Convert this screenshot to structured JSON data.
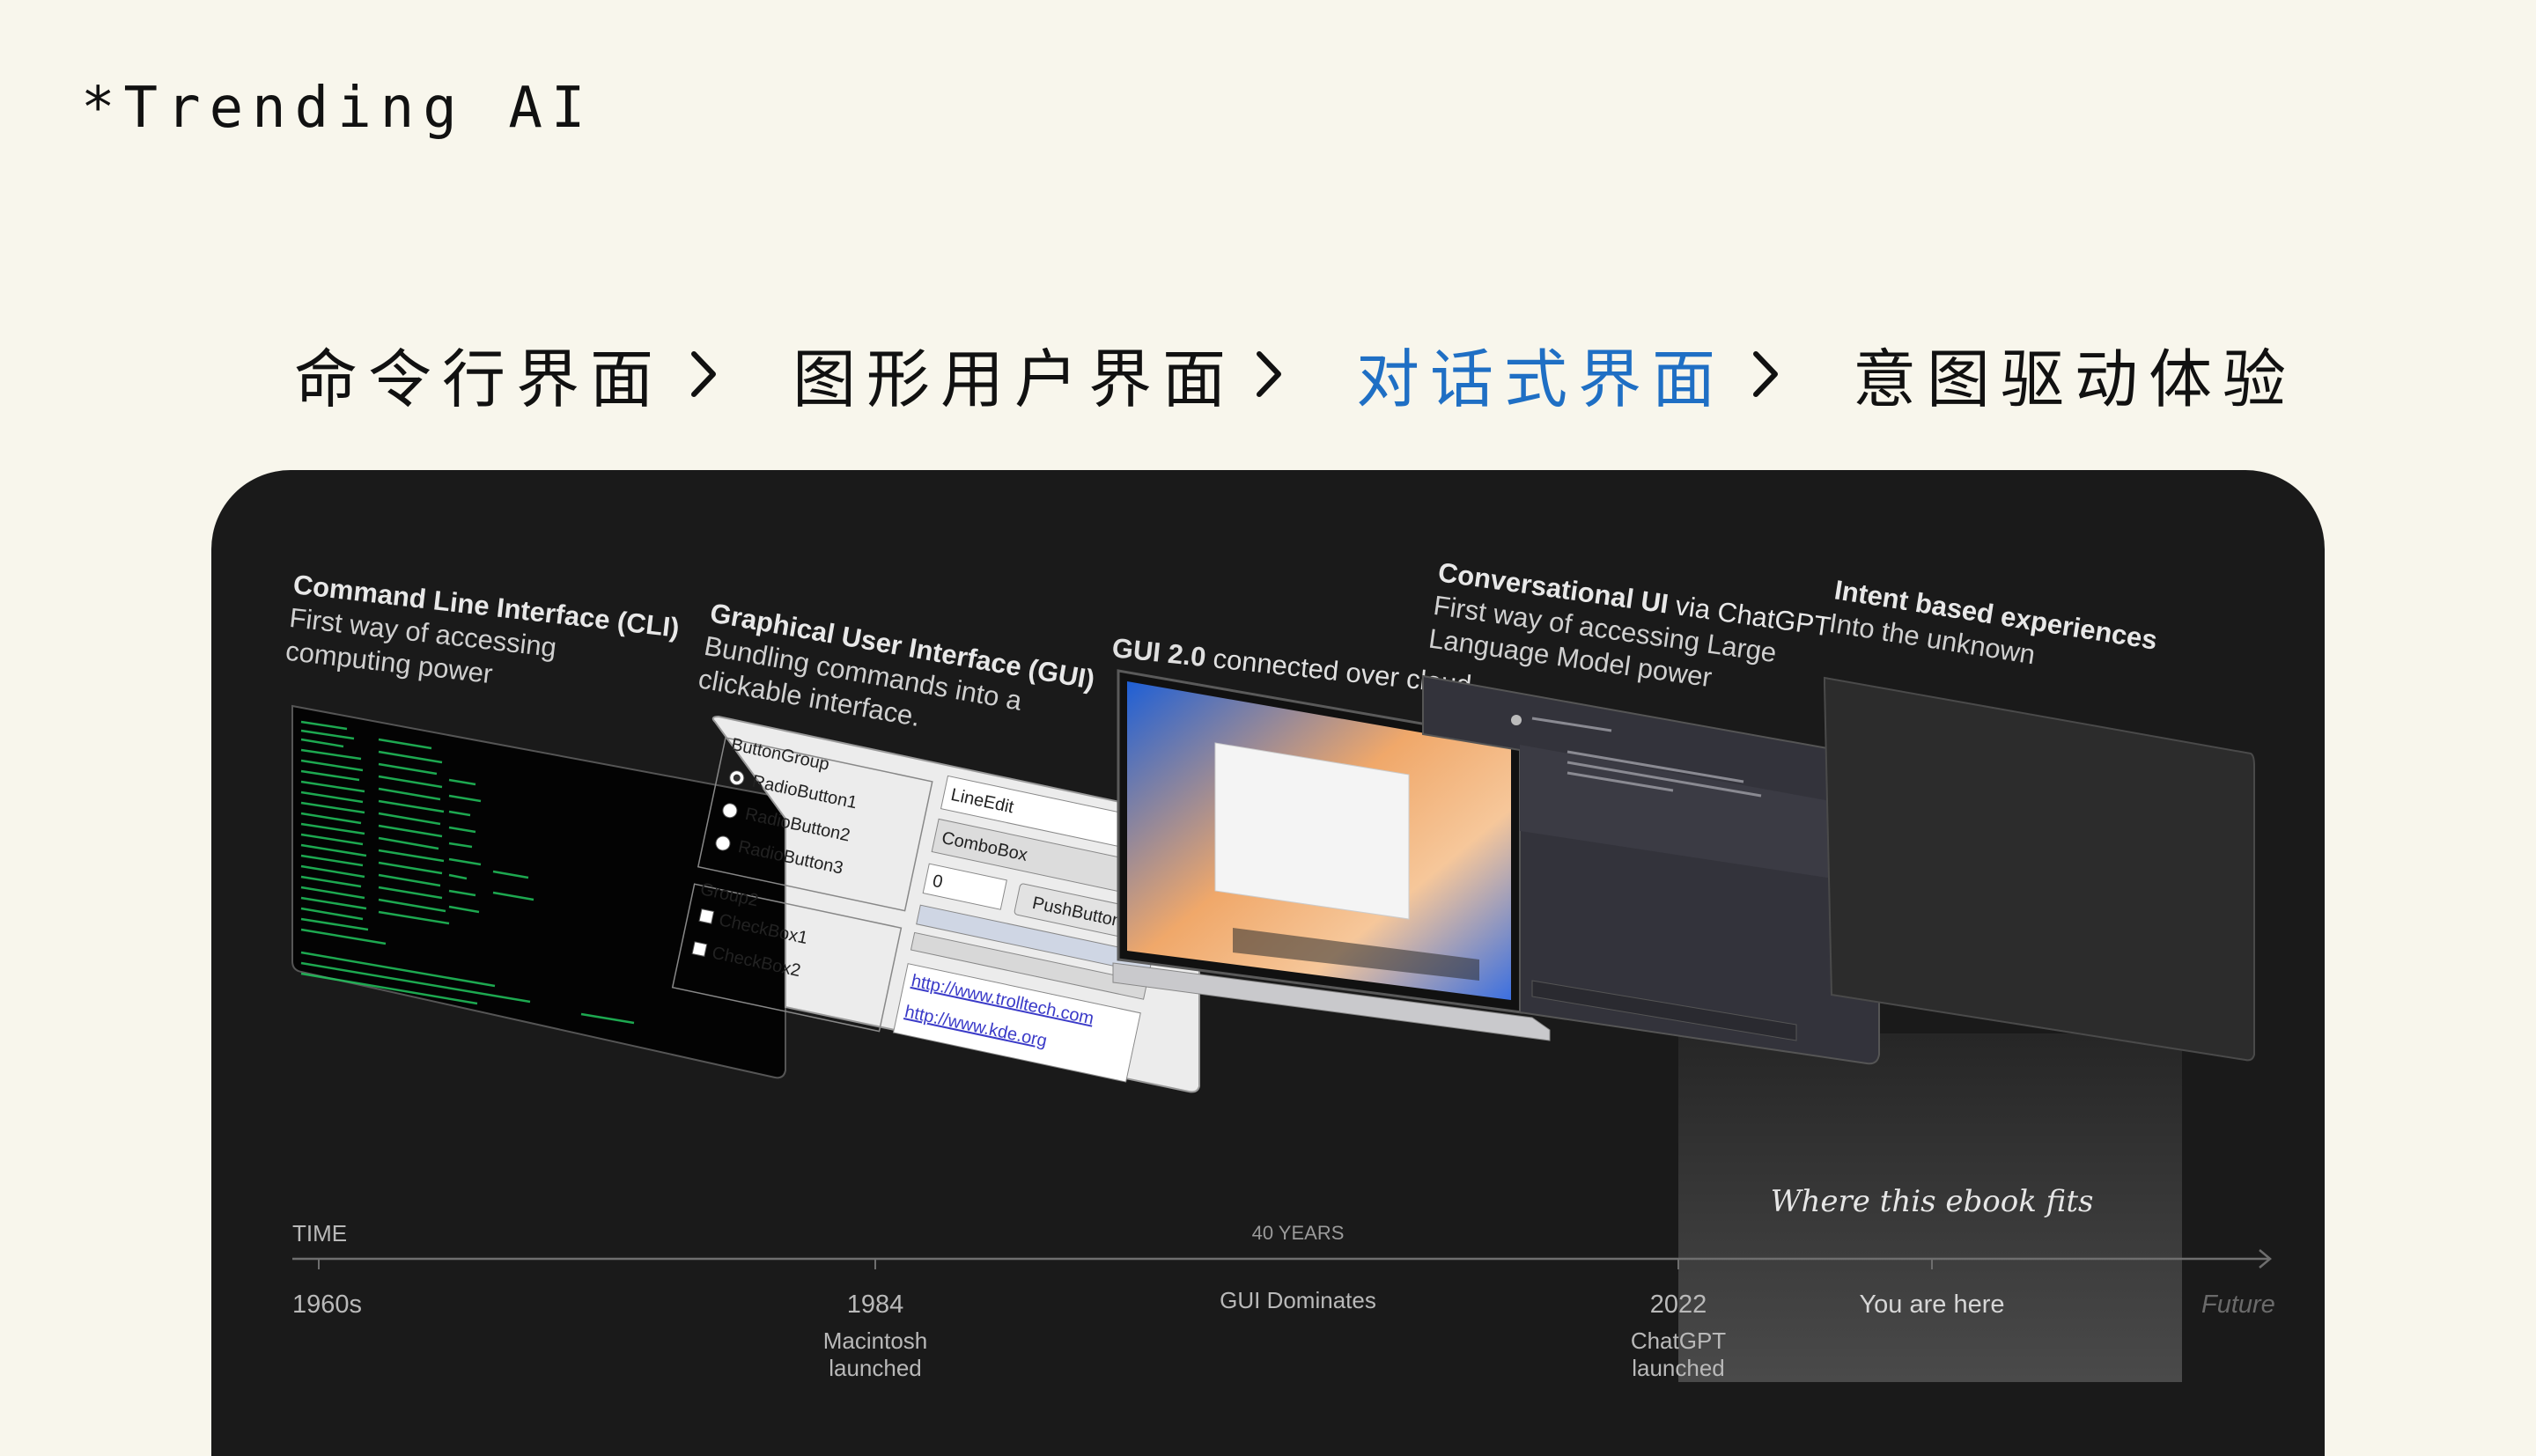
{
  "brand": "*Trending AI",
  "steps": [
    {
      "label": "命令行界面",
      "active": false
    },
    {
      "label": "图形用户界面",
      "active": false
    },
    {
      "label": "对话式界面",
      "active": true
    },
    {
      "label": "意图驱动体验",
      "active": false
    }
  ],
  "colors": {
    "background": "#f8f6ec",
    "panel": "#1a1a1a",
    "accent": "#1f6fc4",
    "terminal_text": "#22c55e"
  },
  "eras": {
    "cli": {
      "title": "Command Line Interface (CLI)",
      "desc1": "First way of accessing",
      "desc2": "computing power"
    },
    "gui": {
      "title": "Graphical User Interface (GUI)",
      "desc1": "Bundling commands into a",
      "desc2": "clickable interface."
    },
    "gui2": {
      "title_bold": "GUI 2.0",
      "title_rest": " connected over cloud"
    },
    "cui": {
      "title_bold": "Conversational UI",
      "title_rest": " via ChatGPT",
      "desc1": "First way of accessing Large",
      "desc2": "Language Model power"
    },
    "intent": {
      "title": "Intent based experiences",
      "desc": "Into the unknown"
    }
  },
  "gui_widgets": {
    "group1": "ButtonGroup",
    "radios": [
      "RadioButton1",
      "RadioButton2",
      "RadioButton3"
    ],
    "group2": "Group2",
    "checks": [
      "CheckBox1",
      "CheckBox2"
    ],
    "lineedit": "LineEdit",
    "combobox": "ComboBox",
    "spin": "0",
    "pushbutton": "PushButton",
    "link1": "http://www.trolltech.com",
    "link2": "http://www.kde.org"
  },
  "timeline": {
    "time_label": "TIME",
    "span_label": "40 YEARS",
    "mid_label": "GUI Dominates",
    "highlight_note": "Where this ebook fits",
    "points": [
      {
        "year": "1960s",
        "note": ""
      },
      {
        "year": "1984",
        "note": "Macintosh launched",
        "note1": "Macintosh",
        "note2": "launched"
      },
      {
        "year": "2022",
        "note": "ChatGPT launched",
        "note1": "ChatGPT",
        "note2": "launched"
      },
      {
        "year": "You are here",
        "note": ""
      },
      {
        "year": "Future",
        "note": ""
      }
    ]
  }
}
